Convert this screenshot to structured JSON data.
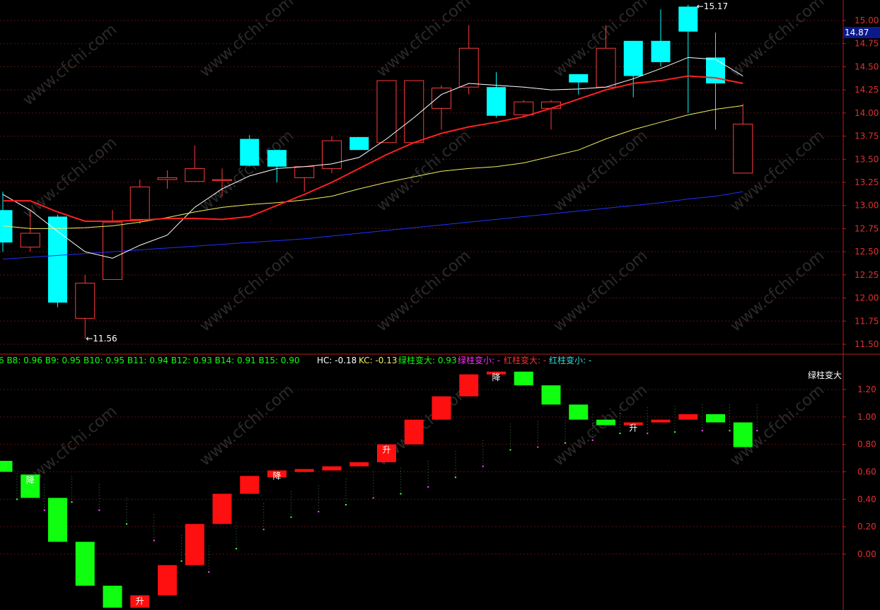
{
  "watermark": "www.cfchi.com",
  "colors": {
    "background": "#000000",
    "axis": "#c01818",
    "grid": "#5a1010",
    "up": "#ff3b3b",
    "down": "#00ffff",
    "ma5": "#ffffff",
    "ma10": "#ff2020",
    "ma20": "#f0f060",
    "ma60": "#2030ff",
    "bar_up": "#ff1010",
    "bar_down": "#10ff10",
    "price_tag_bg": "#0a1a8a"
  },
  "price_panel": {
    "y_ticks": [
      "15.00",
      "14.75",
      "14.50",
      "14.25",
      "14.00",
      "13.75",
      "13.50",
      "13.25",
      "13.00",
      "12.75",
      "12.50",
      "12.25",
      "12.00",
      "11.75",
      "11.50"
    ],
    "current_price": "14.87",
    "high_label": "15.17",
    "low_label": "11.56"
  },
  "indicator_panel": {
    "y_ticks": [
      "1.20",
      "1.00",
      "0.80",
      "0.60",
      "0.40",
      "0.20",
      "0.00"
    ],
    "legend_left": "6  B8: 0.96  B9: 0.95  B10: 0.95  B11: 0.94  B12: 0.93  B14: 0.91  B15: 0.90",
    "legend_hc": "HC: -0.18",
    "legend_kc": "KC: -0.13",
    "legend_green_up": "绿柱变大: 0.93",
    "legend_green_down": "绿柱变小: -",
    "legend_red_up": "红柱变大: -",
    "legend_red_down": "红柱变小: -",
    "corner_label": "绿柱变大",
    "mark_up": "升",
    "mark_down": "降"
  },
  "chart_data": [
    {
      "type": "candlestick",
      "ylim": [
        11.45,
        15.2
      ],
      "candles": [
        {
          "o": 12.95,
          "h": 13.15,
          "l": 12.5,
          "c": 12.6
        },
        {
          "o": 12.55,
          "h": 12.95,
          "l": 12.5,
          "c": 12.7
        },
        {
          "o": 12.88,
          "h": 12.9,
          "l": 11.9,
          "c": 11.95
        },
        {
          "o": 11.78,
          "h": 12.25,
          "l": 11.56,
          "c": 12.16
        },
        {
          "o": 12.2,
          "h": 12.95,
          "l": 12.2,
          "c": 12.82
        },
        {
          "o": 12.85,
          "h": 13.28,
          "l": 12.8,
          "c": 13.2
        },
        {
          "o": 13.28,
          "h": 13.38,
          "l": 13.18,
          "c": 13.3
        },
        {
          "o": 13.26,
          "h": 13.65,
          "l": 13.26,
          "c": 13.4
        },
        {
          "o": 13.27,
          "h": 13.4,
          "l": 13.1,
          "c": 13.28
        },
        {
          "o": 13.72,
          "h": 13.76,
          "l": 13.42,
          "c": 13.43
        },
        {
          "o": 13.6,
          "h": 13.6,
          "l": 13.25,
          "c": 13.42
        },
        {
          "o": 13.3,
          "h": 13.4,
          "l": 13.15,
          "c": 13.42
        },
        {
          "o": 13.4,
          "h": 13.75,
          "l": 13.35,
          "c": 13.7
        },
        {
          "o": 13.74,
          "h": 13.74,
          "l": 13.6,
          "c": 13.6
        },
        {
          "o": 13.68,
          "h": 14.35,
          "l": 13.68,
          "c": 14.35
        },
        {
          "o": 13.68,
          "h": 14.35,
          "l": 13.68,
          "c": 14.35
        },
        {
          "o": 14.05,
          "h": 14.3,
          "l": 13.82,
          "c": 14.27
        },
        {
          "o": 14.28,
          "h": 14.95,
          "l": 14.2,
          "c": 14.7
        },
        {
          "o": 14.28,
          "h": 14.44,
          "l": 13.95,
          "c": 13.97
        },
        {
          "o": 13.98,
          "h": 14.14,
          "l": 13.95,
          "c": 14.12
        },
        {
          "o": 14.05,
          "h": 14.14,
          "l": 13.82,
          "c": 14.12
        },
        {
          "o": 14.42,
          "h": 14.42,
          "l": 14.2,
          "c": 14.33
        },
        {
          "o": 14.28,
          "h": 14.95,
          "l": 14.28,
          "c": 14.7
        },
        {
          "o": 14.78,
          "h": 14.78,
          "l": 14.17,
          "c": 14.4
        },
        {
          "o": 14.78,
          "h": 15.12,
          "l": 14.5,
          "c": 14.55
        },
        {
          "o": 15.15,
          "h": 15.17,
          "l": 14.0,
          "c": 14.88
        },
        {
          "o": 14.6,
          "h": 14.87,
          "l": 13.82,
          "c": 14.32
        },
        {
          "o": 13.35,
          "h": 14.1,
          "l": 13.35,
          "c": 13.88
        }
      ],
      "ma5": [
        13.12,
        12.95,
        12.72,
        12.5,
        12.43,
        12.57,
        12.68,
        12.98,
        13.18,
        13.32,
        13.4,
        13.42,
        13.45,
        13.52,
        13.72,
        13.95,
        14.2,
        14.32,
        14.3,
        14.28,
        14.25,
        14.26,
        14.28,
        14.37,
        14.48,
        14.6,
        14.58,
        14.4
      ],
      "ma10": [
        13.05,
        13.05,
        12.93,
        12.83,
        12.83,
        12.84,
        12.86,
        12.86,
        12.85,
        12.88,
        13.0,
        13.12,
        13.25,
        13.4,
        13.55,
        13.68,
        13.78,
        13.85,
        13.9,
        13.96,
        14.05,
        14.15,
        14.25,
        14.32,
        14.35,
        14.4,
        14.38,
        14.32
      ],
      "ma20": [
        12.78,
        12.75,
        12.75,
        12.76,
        12.78,
        12.82,
        12.87,
        12.93,
        12.98,
        13.01,
        13.03,
        13.06,
        13.1,
        13.18,
        13.25,
        13.31,
        13.37,
        13.4,
        13.42,
        13.46,
        13.53,
        13.6,
        13.72,
        13.82,
        13.9,
        13.98,
        14.04,
        14.08
      ],
      "ma60": [
        12.42,
        12.44,
        12.46,
        12.48,
        12.5,
        12.52,
        12.54,
        12.56,
        12.58,
        12.6,
        12.62,
        12.64,
        12.67,
        12.7,
        12.73,
        12.76,
        12.79,
        12.82,
        12.85,
        12.88,
        12.91,
        12.94,
        12.97,
        13.0,
        13.03,
        13.07,
        13.1,
        13.15
      ]
    },
    {
      "type": "bar",
      "ylim": [
        -0.22,
        1.32
      ],
      "bars": [
        {
          "top": 0.68,
          "bottom": 0.6,
          "dir": "down"
        },
        {
          "top": 0.58,
          "bottom": 0.41,
          "dir": "down"
        },
        {
          "top": 0.41,
          "bottom": 0.09,
          "dir": "down"
        },
        {
          "top": 0.09,
          "bottom": -0.23,
          "dir": "down"
        },
        {
          "top": -0.23,
          "bottom": -0.39,
          "dir": "down"
        },
        {
          "top": -0.3,
          "bottom": -0.39,
          "dir": "up"
        },
        {
          "top": -0.08,
          "bottom": -0.3,
          "dir": "up"
        },
        {
          "top": 0.22,
          "bottom": -0.08,
          "dir": "up"
        },
        {
          "top": 0.44,
          "bottom": 0.22,
          "dir": "up"
        },
        {
          "top": 0.57,
          "bottom": 0.44,
          "dir": "up"
        },
        {
          "top": 0.61,
          "bottom": 0.56,
          "dir": "up"
        },
        {
          "top": 0.62,
          "bottom": 0.61,
          "dir": "up"
        },
        {
          "top": 0.64,
          "bottom": 0.61,
          "dir": "up"
        },
        {
          "top": 0.67,
          "bottom": 0.64,
          "dir": "up"
        },
        {
          "top": 0.8,
          "bottom": 0.67,
          "dir": "up"
        },
        {
          "top": 0.98,
          "bottom": 0.8,
          "dir": "up"
        },
        {
          "top": 1.15,
          "bottom": 0.98,
          "dir": "up"
        },
        {
          "top": 1.31,
          "bottom": 1.15,
          "dir": "up"
        },
        {
          "top": 1.33,
          "bottom": 1.31,
          "dir": "up"
        },
        {
          "top": 1.33,
          "bottom": 1.23,
          "dir": "down"
        },
        {
          "top": 1.23,
          "bottom": 1.09,
          "dir": "down"
        },
        {
          "top": 1.09,
          "bottom": 0.98,
          "dir": "down"
        },
        {
          "top": 0.98,
          "bottom": 0.94,
          "dir": "down"
        },
        {
          "top": 0.96,
          "bottom": 0.94,
          "dir": "up"
        },
        {
          "top": 0.98,
          "bottom": 0.96,
          "dir": "up"
        },
        {
          "top": 1.02,
          "bottom": 0.98,
          "dir": "up"
        },
        {
          "top": 1.02,
          "bottom": 0.96,
          "dir": "down"
        },
        {
          "top": 0.96,
          "bottom": 0.78,
          "dir": "down"
        }
      ],
      "dots": [
        0.4,
        0.32,
        0.38,
        0.32,
        0.22,
        0.1,
        -0.05,
        -0.13,
        0.04,
        0.18,
        0.27,
        0.31,
        0.36,
        0.41,
        0.44,
        0.49,
        0.56,
        0.64,
        0.76,
        0.78,
        0.81,
        0.83,
        0.88,
        0.88,
        0.89,
        0.9,
        0.9,
        0.9
      ],
      "markers": [
        {
          "i": 1,
          "label": "降"
        },
        {
          "i": 5,
          "label": "升"
        },
        {
          "i": 10,
          "label": "降"
        },
        {
          "i": 14,
          "label": "升"
        },
        {
          "i": 18,
          "label": "降"
        },
        {
          "i": 23,
          "label": "升"
        }
      ]
    }
  ]
}
